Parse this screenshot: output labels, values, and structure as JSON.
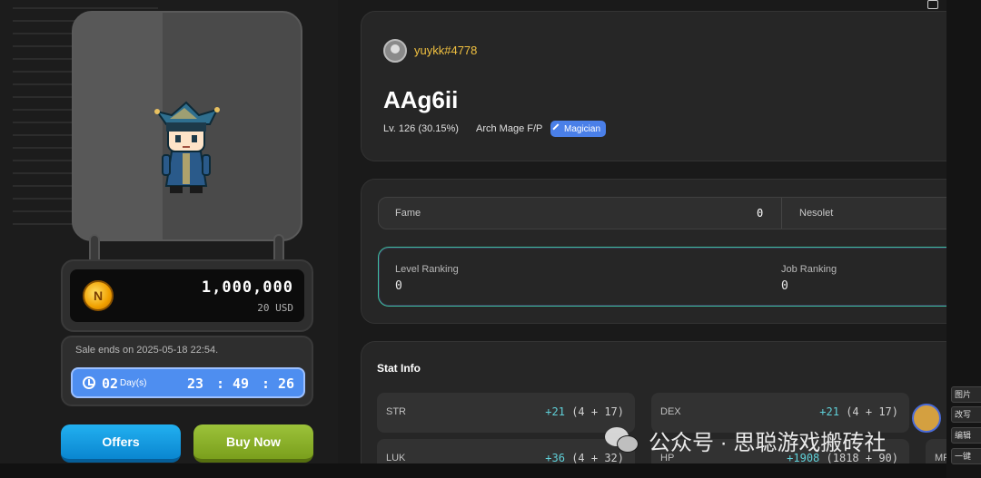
{
  "left": {
    "price": {
      "amount": "1,000,000",
      "usd": "20 USD",
      "coin_letter": "N"
    },
    "sale": {
      "ends_text": "Sale ends on 2025-05-18 22:54.",
      "days": "02",
      "day_unit": "Day(s)",
      "hours": "23",
      "minutes": "49",
      "seconds": "26",
      "separator": ":"
    },
    "buttons": {
      "offers": "Offers",
      "buy_now": "Buy Now"
    }
  },
  "profile": {
    "username": "yuykk#4778",
    "character_name": "AAg6ii",
    "level": "Lv. 126 (30.15%)",
    "job": "Arch Mage F/P",
    "class_badge": "Magician"
  },
  "info": {
    "fame_label": "Fame",
    "fame_value": "0",
    "guild_label": "Nesolet",
    "level_ranking_label": "Level Ranking",
    "level_ranking_value": "0",
    "job_ranking_label": "Job Ranking",
    "job_ranking_value": "0"
  },
  "stats": {
    "title": "Stat Info",
    "rows": [
      {
        "name": "STR",
        "total": "+21",
        "detail": "(4 + 17)"
      },
      {
        "name": "DEX",
        "total": "+21",
        "detail": "(4 + 17)"
      },
      {
        "name": "LUK",
        "total": "+36",
        "detail": "(4 + 32)"
      },
      {
        "name": "HP",
        "total": "+1908",
        "detail": "(1818 + 90)"
      }
    ],
    "partial_label": "MP"
  },
  "side_toolbar": [
    "图片",
    "改写",
    "编辑",
    "一键"
  ],
  "watermark": {
    "text": "公众号 · 思聪游戏搬砖社"
  },
  "colors": {
    "accent_blue": "#4e8ef0",
    "username_gold": "#f0c040",
    "stat_cyan": "#5fd0d8",
    "offers": "#0a86d0",
    "buy_now": "#7a9f1c"
  }
}
